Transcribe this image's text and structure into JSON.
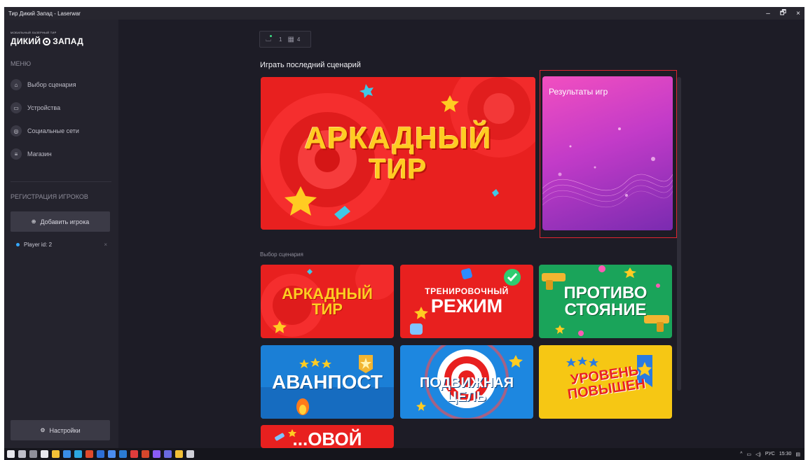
{
  "window": {
    "title": "Тир Дикий Запад - Laserwar",
    "controls": {
      "minimize": "–",
      "restore": "🗗",
      "close": "×"
    }
  },
  "sidebar": {
    "logo_small": "МОБИЛЬНЫЙ ЛАЗЕРНЫЙ ТИР",
    "logo_text_left": "ДИКИЙ",
    "logo_text_right": "ЗАПАД",
    "menu_label": "МЕНЮ",
    "menu_items": [
      {
        "label": "Выбор сценария",
        "icon": "home-icon"
      },
      {
        "label": "Устройства",
        "icon": "devices-icon"
      },
      {
        "label": "Социальные сети",
        "icon": "globe-icon"
      },
      {
        "label": "Магазин",
        "icon": "store-icon"
      }
    ],
    "registration_label": "РЕГИСТРАЦИЯ ИГРОКОВ",
    "add_player_label": "Добавить игрока",
    "players": [
      {
        "label": "Player id: 2"
      }
    ],
    "settings_label": "Настройки"
  },
  "main": {
    "status": {
      "players_count": "1",
      "devices_count": "4"
    },
    "last_scenario_title": "Играть последний сценарий",
    "hero": {
      "line1": "АРКАДНЫЙ",
      "line2": "ТИР"
    },
    "results_label": "Результаты игр",
    "scenario_section_title": "Выбор сценария",
    "scenarios": [
      {
        "line1": "АРКАДНЫЙ",
        "line2": "ТИР"
      },
      {
        "line1": "ТРЕНИРОВОЧНЫЙ",
        "line2": "РЕЖИМ"
      },
      {
        "line1": "ПРОТИВО",
        "line2": "СТОЯНИЕ"
      },
      {
        "line1": "АВАНПОСТ",
        "line2": ""
      },
      {
        "line1": "ПОДВИЖНАЯ",
        "line2": "ЦЕЛЬ"
      },
      {
        "line1": "УРОВЕНЬ",
        "line2": "ПОВЫШЕН"
      },
      {
        "line1": "...ОВОЙ",
        "line2": ""
      }
    ]
  },
  "taskbar": {
    "language": "РУС",
    "time": "15:30"
  },
  "colors": {
    "background": "#1d1c26",
    "sidebar": "#24232d",
    "accent_red": "#e8201f",
    "highlight_border": "#e0252f",
    "results_gradient_start": "#f24fc0",
    "results_gradient_end": "#7a2bb0"
  }
}
